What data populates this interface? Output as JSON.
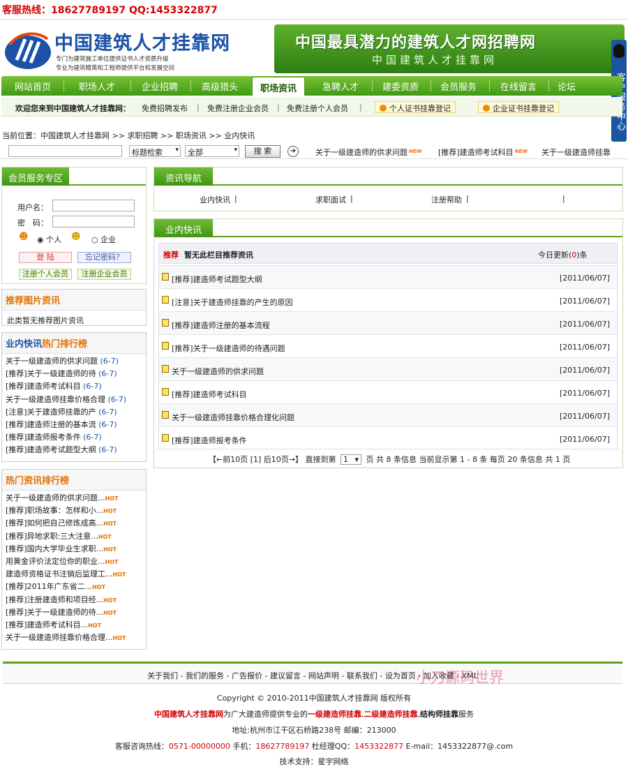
{
  "topbar": {
    "hotline": "客服热线：18627789197 QQ:1453322877"
  },
  "logo": {
    "name": "中国建筑人才挂靠网",
    "slogan1": "专门为建筑施工单位提供证书人才资质升级",
    "slogan2": "专业为建筑精英和工程师提供平台和发展空间"
  },
  "banner": {
    "line1": "中国最具潜力的建筑人才网招聘网",
    "line2": "中国建筑人才挂靠网"
  },
  "side_tab": {
    "label": "客户服务中心"
  },
  "nav": [
    "网站首页",
    "职场人才",
    "企业招聘",
    "高级猎头",
    "职场资讯",
    "急聘人才",
    "建委资质",
    "会员服务",
    "在线留言",
    "论坛"
  ],
  "welcome": {
    "title": "欢迎您来到中国建筑人才挂靠网：",
    "link1": "免费招聘发布",
    "link2": "免费注册企业会员",
    "link3": "免费注册个人会员",
    "sep": "|",
    "cert1": "个人证书挂靠登记",
    "cert2": "企业证书挂靠登记"
  },
  "breadcrumb": "当前位置：中国建筑人才挂靠网 >> 求职招聘 >> 职场资讯 >> 业内快讯",
  "search": {
    "keyword_value": "",
    "type_select": "标题检索",
    "scope_select": "全部",
    "button": "搜 索",
    "go_icon": "arrow-right-icon"
  },
  "marquee": [
    {
      "text": "关于一级建造师的供求问题",
      "badge": "NEW"
    },
    {
      "text": "[推荐]建造师考试科目",
      "badge": "NEW"
    },
    {
      "text": "关于一级建造师挂靠",
      "badge": ""
    }
  ],
  "member": {
    "title": "会员服务专区",
    "user_label": "用户名：",
    "pass_label": "密　码：",
    "role_person": "个人",
    "role_company": "企业",
    "login": "登 陆",
    "forgot": "忘记密码？",
    "reg_person": "注册个人会员",
    "reg_company": "注册企业会员"
  },
  "pic_news": {
    "title": "推荐图片资讯",
    "empty": "此类暂无推荐图片资讯"
  },
  "rank1": {
    "title_part1": "业内快讯",
    "title_part2": "热门排行榜",
    "items": [
      {
        "text": "关于一级建造师的供求问题",
        "date": "(6-7)"
      },
      {
        "text": "[推荐]关于一级建造师的待",
        "date": "(6-7)"
      },
      {
        "text": "[推荐]建造师考试科目",
        "date": "(6-7)"
      },
      {
        "text": "关于一级建造师挂靠价格合理",
        "date": "(6-7)"
      },
      {
        "text": "[注意]关于建造师挂靠的产",
        "date": "(6-7)"
      },
      {
        "text": "[推荐]建造师注册的基本流",
        "date": "(6-7)"
      },
      {
        "text": "[推荐]建造师报考条件",
        "date": "(6-7)"
      },
      {
        "text": "[推荐]建造师考试题型大纲",
        "date": "(6-7)"
      }
    ]
  },
  "rank2": {
    "title": "热门资讯排行榜",
    "hot_badge": "HOT",
    "items": [
      "关于一级建造师的供求问题...",
      "[推荐]职场故事：怎样和小...",
      "[推荐]如何把自己修炼成高...",
      "[推荐]异地求职:三大注意...",
      "[推荐]国内大学毕业生求职...",
      "用黄金评价法定位你的职业...",
      "建造师资格证书注销后监理工...",
      "[推荐]2011年广东省二...",
      "[推荐]注册建造师和项目经...",
      "[推荐]关于一级建造师的待...",
      "[推荐]建造师考试科目...",
      "关于一级建造师挂靠价格合理..."
    ]
  },
  "guide": {
    "title": "资讯导航",
    "items": [
      "业内快讯",
      "求职面试",
      "注册帮助",
      ""
    ],
    "sep": "|"
  },
  "news": {
    "title": "业内快讯",
    "rec_label": "推荐",
    "rec_text": "暂无此栏目推荐资讯",
    "today_prefix": "今日更新(",
    "today_count": "0",
    "today_suffix": ")条",
    "rows": [
      {
        "title": "[推荐]建造师考试题型大纲",
        "date": "[2011/06/07]"
      },
      {
        "title": "[注意]关于建造师挂靠的产生的原因",
        "date": "[2011/06/07]"
      },
      {
        "title": "[推荐]建造师注册的基本流程",
        "date": "[2011/06/07]"
      },
      {
        "title": "[推荐]关于一级建造师的待遇问题",
        "date": "[2011/06/07]"
      },
      {
        "title": "关于一级建造师的供求问题",
        "date": "[2011/06/07]"
      },
      {
        "title": "[推荐]建造师考试科目",
        "date": "[2011/06/07]"
      },
      {
        "title": "关于一级建造师挂靠价格合理化问题",
        "date": "[2011/06/07]"
      },
      {
        "title": "[推荐]建造师报考条件",
        "date": "[2011/06/07]"
      }
    ],
    "pager_left": "【←前10页 [1] 后10页→】 直接到第",
    "pager_select": "1",
    "pager_right": "页 共 8 条信息 当前显示第 1 - 8 条 每页 20 条信息 共 1 页"
  },
  "footer": {
    "links": "关于我们 - 我们的服务 - 广告报价 - 建议留言 - 网站声明 - 联系我们 - 设为首页 - 加入收藏 - XML",
    "watermark": "小刀源码世界",
    "copyright": "Copyright © 2010-2011中国建筑人才挂靠网 版权所有",
    "svc_a": "中国建筑人才挂靠网",
    "svc_b": "为广大建造师提供专业的",
    "svc_c": "一级建造师挂靠",
    "svc_d": "二级建造师挂靠",
    "svc_e": "结构师挂靠",
    "svc_f": "服务",
    "address": "地址:杭州市江干区石桥路238号 邮编：213000",
    "hot_prefix": "客服咨询热线：",
    "hot_phone": "0571-00000000",
    "mobile_prefix": " 手机：",
    "mobile": "18627789197",
    "qq_prefix": " 杜经理QQ：",
    "qq": "1453322877",
    "email_prefix": " E-mail：",
    "email": "1453322877@.com",
    "support": "技术支持：星宇网络"
  },
  "colors": {
    "green": "#4d9e1a",
    "orange": "#e07000",
    "red": "#d40000",
    "blue": "#1b52a8"
  }
}
